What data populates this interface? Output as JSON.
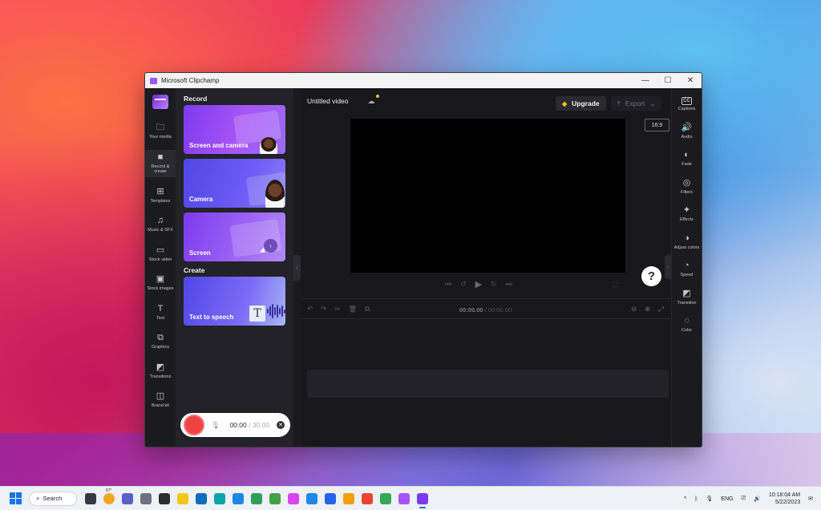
{
  "window": {
    "title": "Microsoft Clipchamp",
    "minimize": "—",
    "maximize": "☐",
    "close": "✕"
  },
  "leftnav": [
    {
      "icon": "folder-icon",
      "glyph": "🗀",
      "label": "Your media"
    },
    {
      "icon": "video-camera-icon",
      "glyph": "■",
      "label": "Record & create",
      "active": true
    },
    {
      "icon": "templates-icon",
      "glyph": "⊞",
      "label": "Templates"
    },
    {
      "icon": "music-note-icon",
      "glyph": "♫",
      "label": "Music & SFX"
    },
    {
      "icon": "film-icon",
      "glyph": "▭",
      "label": "Stock video"
    },
    {
      "icon": "image-icon",
      "glyph": "▣",
      "label": "Stock images"
    },
    {
      "icon": "text-icon",
      "glyph": "T",
      "label": "Text"
    },
    {
      "icon": "shapes-icon",
      "glyph": "⧉",
      "label": "Graphics"
    },
    {
      "icon": "transitions-icon",
      "glyph": "◩",
      "label": "Transitions"
    },
    {
      "icon": "brand-kit-icon",
      "glyph": "◫",
      "label": "Brand kit"
    }
  ],
  "panel": {
    "record_heading": "Record",
    "cards": [
      "Screen and camera",
      "Camera",
      "Screen"
    ],
    "create_heading": "Create",
    "create_card": "Text to speech",
    "tts_letter": "T",
    "card_arrow": "›",
    "timer_current": "00:00",
    "timer_separator": " / ",
    "timer_total": "30:00",
    "mic_glyph": "🎙",
    "close_glyph": "✕"
  },
  "collapse_glyph": "‹",
  "editor": {
    "title": "Untitled video",
    "cloud_glyph": "☁",
    "upgrade_label": "Upgrade",
    "gem_glyph": "◆",
    "export_label": "Export",
    "export_glyphs": {
      "upload": "⤒",
      "chevron": "⌄"
    },
    "aspect_ratio": "16:9",
    "help_label": "?",
    "transport": {
      "prev": "⏮",
      "back": "↺",
      "play": "▶",
      "fwd": "↻",
      "next": "⏭"
    },
    "fullscreen_glyph": "⛶",
    "timeline_tools": {
      "undo": "↶",
      "redo": "↷",
      "split": "✂",
      "delete": "🗑",
      "duplicate": "⧉"
    },
    "time_current": "00:00.00",
    "time_separator": " / ",
    "time_total": "00:00.00",
    "zoom": {
      "out": "⊖",
      "in": "⊕",
      "fit": "⤢"
    }
  },
  "rightbar": [
    {
      "icon": "captions-icon",
      "glyph": "CC",
      "label": "Captions"
    },
    {
      "icon": "audio-icon",
      "glyph": "🔊",
      "label": "Audio"
    },
    {
      "icon": "fade-icon",
      "glyph": "◐",
      "label": "Fade"
    },
    {
      "icon": "filters-icon",
      "glyph": "◎",
      "label": "Filters"
    },
    {
      "icon": "effects-icon",
      "glyph": "✦",
      "label": "Effects"
    },
    {
      "icon": "adjust-colors-icon",
      "glyph": "◑",
      "label": "Adjust colors"
    },
    {
      "icon": "speed-icon",
      "glyph": "◔",
      "label": "Speed"
    },
    {
      "icon": "transition-icon",
      "glyph": "◩",
      "label": "Transition"
    },
    {
      "icon": "color-icon",
      "glyph": "◌",
      "label": "Color"
    }
  ],
  "taskbar": {
    "search_label": "Search",
    "search_glyph": "⌕",
    "weather": "67°",
    "apps": [
      {
        "icon": "task-view-icon",
        "color": "#333842"
      },
      {
        "icon": "weather-icon",
        "color": "#f5a623"
      },
      {
        "icon": "chat-icon",
        "color": "#5b5fc7"
      },
      {
        "icon": "settings-icon",
        "color": "#6b7280"
      },
      {
        "icon": "terminal-icon",
        "color": "#2d2d2d"
      },
      {
        "icon": "file-explorer-icon",
        "color": "#f5c518"
      },
      {
        "icon": "outlook-icon",
        "color": "#0f6cbd"
      },
      {
        "icon": "edge-icon",
        "color": "#0ea5a5"
      },
      {
        "icon": "edge-beta-icon",
        "color": "#1e88e5"
      },
      {
        "icon": "edge-dev-icon",
        "color": "#2e9e5b"
      },
      {
        "icon": "edge-canary-icon",
        "color": "#43a047"
      },
      {
        "icon": "snipping-tool-icon",
        "color": "#d946ef"
      },
      {
        "icon": "notepad-icon",
        "color": "#1e88e5"
      },
      {
        "icon": "store-icon",
        "color": "#2563eb"
      },
      {
        "icon": "chrome-canary-icon",
        "color": "#f59e0b"
      },
      {
        "icon": "chrome-icon",
        "color": "#ea4335"
      },
      {
        "icon": "app-grid-icon",
        "color": "#34a853"
      },
      {
        "icon": "paint-icon",
        "color": "#a855f7"
      },
      {
        "icon": "clipchamp-icon",
        "color": "#7c3aed",
        "active": true
      }
    ],
    "tray": {
      "chevron": "^",
      "bluetooth": "ᛒ",
      "mic": "🎙",
      "language": "ENG",
      "network": "⎚",
      "volume": "🔊",
      "time": "10:18:04 AM",
      "date": "5/22/2023",
      "notification": "✉"
    }
  }
}
